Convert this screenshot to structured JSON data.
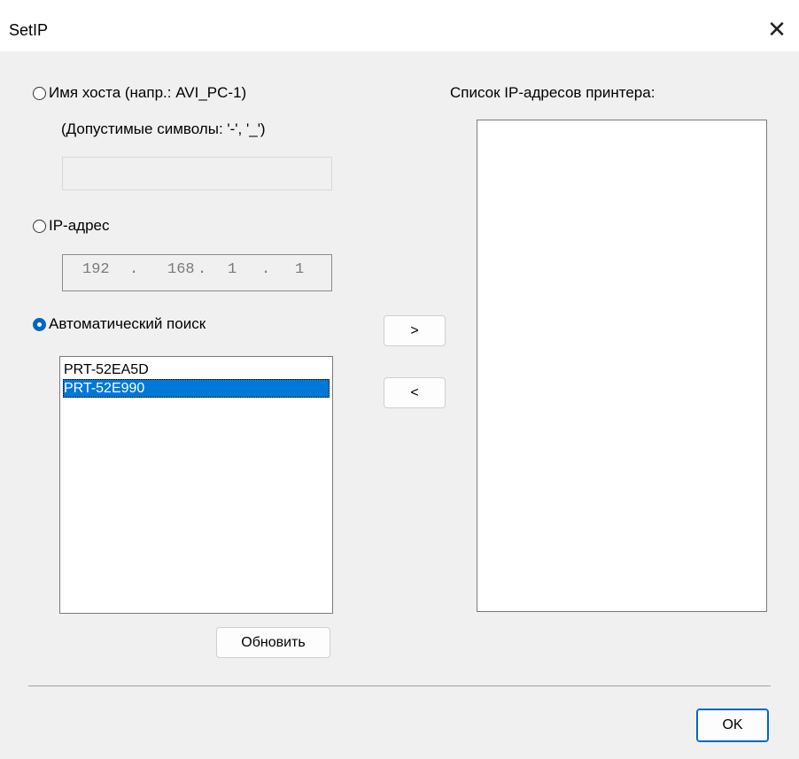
{
  "window": {
    "title": "SetIP",
    "close_glyph": "✕"
  },
  "hostname": {
    "radio_label": "Имя хоста (напр.: AVI_PC-1)",
    "hint": "(Допустимые символы: '-', '_')",
    "value": "",
    "checked": false
  },
  "ip": {
    "radio_label": "IP-адрес",
    "octets": [
      "192",
      "168",
      "1",
      "1"
    ],
    "dots": [
      ".",
      ".",
      "."
    ],
    "checked": false
  },
  "auto": {
    "radio_label": "Автоматический поиск",
    "checked": true,
    "found": [
      "PRT-52EA5D",
      "PRT-52E990"
    ],
    "selected_index": 1,
    "refresh_label": "Обновить"
  },
  "transfer": {
    "add_label": ">",
    "remove_label": "<"
  },
  "printer_list": {
    "label": "Список IP-адресов принтера:",
    "items": []
  },
  "ok_label": "OK"
}
